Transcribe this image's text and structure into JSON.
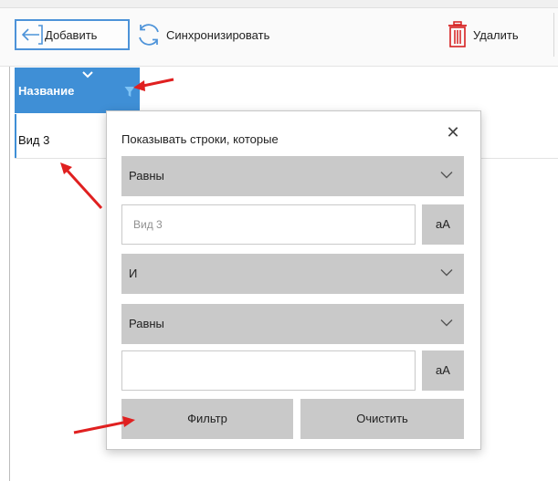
{
  "toolbar": {
    "add_label": "Добавить",
    "sync_label": "Синхронизировать",
    "delete_label": "Удалить"
  },
  "grid": {
    "column_header": "Название",
    "rows": [
      {
        "name": "Вид 3"
      }
    ]
  },
  "filter_popup": {
    "title": "Показывать строки, которые",
    "condition1": {
      "operator": "Равны",
      "value": "Вид 3",
      "case_label": "aA"
    },
    "logic": "И",
    "condition2": {
      "operator": "Равны",
      "value": "",
      "case_label": "aA"
    },
    "filter_button": "Фильтр",
    "clear_button": "Очистить",
    "close_glyph": "✕"
  },
  "colors": {
    "accent": "#3f8fd6",
    "annotation": "#e02020",
    "control_gray": "#c9c9c9"
  },
  "icons": [
    "back-arrow-icon",
    "sync-icon",
    "trash-icon",
    "chevron-down-icon",
    "filter-icon",
    "close-icon"
  ]
}
